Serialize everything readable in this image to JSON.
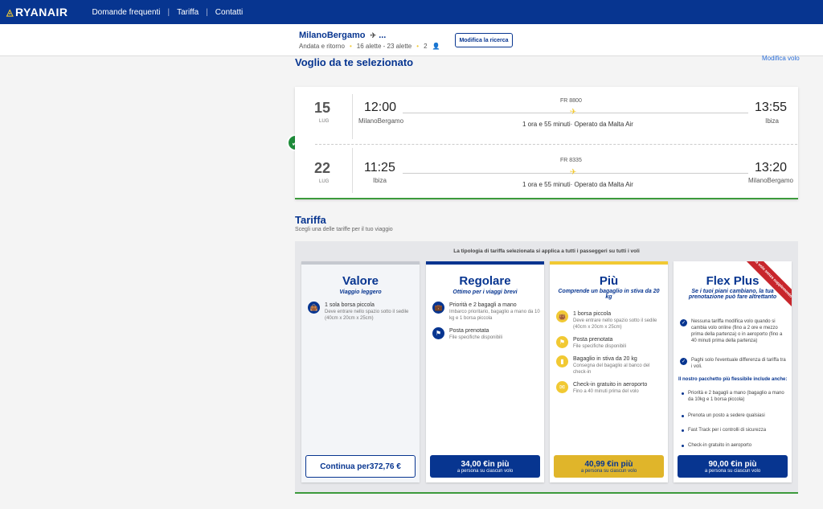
{
  "header": {
    "logo": "RYANAIR",
    "nav": [
      "Domande frequenti",
      "Tariffa",
      "Contatti"
    ]
  },
  "search": {
    "route": "MilanoBergamo",
    "route_suffix": "...",
    "trip_type": "Andata e ritorno",
    "dates": "16 alette - 23 alette",
    "passengers": "2",
    "modify_button": "Modifica la ricerca"
  },
  "selected": {
    "title": "Voglio da te selezionato",
    "modify_link": "Modifica volo",
    "flights": [
      {
        "day": "15",
        "month": "LUG",
        "dep_time": "12:00",
        "dep_city": "MilanoBergamo",
        "flight_no": "FR 8800",
        "duration": "1 ora e 55 minuti",
        "operator": "Operato da Malta Air",
        "arr_time": "13:55",
        "arr_city": "Ibiza"
      },
      {
        "day": "22",
        "month": "LUG",
        "dep_time": "11:25",
        "dep_city": "Ibiza",
        "flight_no": "FR 8335",
        "duration": "1 ora e 55 minuti",
        "operator": "Operato da Malta Air",
        "arr_time": "13:20",
        "arr_city": "MilanoBergamo"
      }
    ]
  },
  "tariff": {
    "title": "Tariffa",
    "subtitle": "Scegli una delle tariffe per il tuo viaggio",
    "note": "La tipologia di tariffa selezionata si applica a tutti i passeggeri su tutti i voli",
    "cards": [
      {
        "name": "Valore",
        "tagline": "Viaggio leggero",
        "accent": "#c5c8cf",
        "features": [
          {
            "icon": "small-bag-icon",
            "title": "1 sola borsa piccola",
            "sub": "Deve entrare nello spazio sotto il sedile (40cm x 20cm x 25cm)"
          }
        ],
        "cta_price": "Continua per372,76 €",
        "cta_sub": ""
      },
      {
        "name": "Regolare",
        "tagline": "Ottimo per i viaggi brevi",
        "accent": "#073590",
        "features": [
          {
            "icon": "priority-bags-icon",
            "title": "Priorità e 2 bagagli a mano",
            "sub": "Imbarco prioritario, bagaglio a mano da 10 kg e 1 borsa piccola"
          },
          {
            "icon": "seat-icon",
            "title": "Posta prenotata",
            "sub": "File specifiche disponibili"
          }
        ],
        "cta_price": "34,00 €in più",
        "cta_sub": "a persona su ciascun volo"
      },
      {
        "name": "Più",
        "tagline": "Comprende un bagaglio in stiva da 20 kg",
        "accent": "#f1c933",
        "features": [
          {
            "icon": "small-bag-icon",
            "title": "1 borsa piccola",
            "sub": "Deve entrare nello spazio sotto il sedile (40cm x 20cm x 25cm)"
          },
          {
            "icon": "seat-icon",
            "title": "Posta prenotata",
            "sub": "File specifiche disponibili"
          },
          {
            "icon": "checked-bag-icon",
            "title": "Bagaglio in stiva da 20 kg",
            "sub": "Consegna del bagaglio al banco del check-in"
          },
          {
            "icon": "checkin-icon",
            "title": "Check-in gratuito in aeroporto",
            "sub": "Fino a 40 minuti prima del volo"
          }
        ],
        "cta_price": "40,99 €in più",
        "cta_sub": "a persona su ciascun volo"
      },
      {
        "name": "Flex Plus",
        "tagline": "Se i tuoi piani cambiano, la tua prenotazione può fare altrettanto",
        "accent": "#ffffff",
        "ribbon": "Cambia volo senza supplemento",
        "checks": [
          "Nessuna tariffa modifica volo quando si cambia volo online (fino a 2 ore e mezzo prima della partenza) o in aeroporto (fino a 40 minuti prima della partenza)",
          "Paghi solo l'eventuale differenza di tariffa tra i voli."
        ],
        "package_title": "Il nostro pacchetto più flessibile include anche:",
        "bullets": [
          "Priorità e 2 bagagli a mano (bagaglio a mano da 10kg e 1 borsa piccola)",
          "Prenota un posto a sedere qualsiasi",
          "Fast Track per i controlli di sicurezza",
          "Check-in gratuito in aeroporto"
        ],
        "cta_price": "90,00 €in più",
        "cta_sub": "a persona su ciascun volo"
      }
    ]
  }
}
